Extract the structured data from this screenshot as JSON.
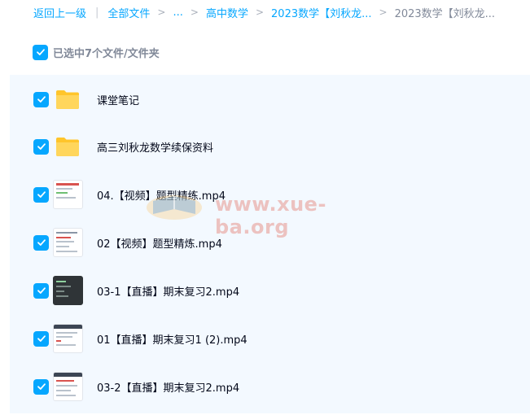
{
  "breadcrumb": {
    "back": "返回上一级",
    "all_files": "全部文件",
    "ellipsis": "...",
    "level1": "高中数学",
    "level2": "2023数学【刘秋龙...",
    "current": "2023数学【刘秋龙..."
  },
  "selection": {
    "label": "已选中7个文件/文件夹"
  },
  "files": [
    {
      "name": "课堂笔记",
      "type": "folder"
    },
    {
      "name": "高三刘秋龙数学续保资料",
      "type": "folder"
    },
    {
      "name": "04.【视频】题型精练.mp4",
      "type": "video"
    },
    {
      "name": "02【视频】题型精炼.mp4",
      "type": "video"
    },
    {
      "name": "03-1【直播】期末复习2.mp4",
      "type": "video"
    },
    {
      "name": "01【直播】期末复习1 (2).mp4",
      "type": "video"
    },
    {
      "name": "03-2【直播】期末复习2.mp4",
      "type": "video"
    }
  ],
  "watermark": "www.xue-ba.org",
  "colors": {
    "accent": "#06a7ff",
    "list_bg": "#f3f9ff",
    "folder": "#ffc52b"
  }
}
